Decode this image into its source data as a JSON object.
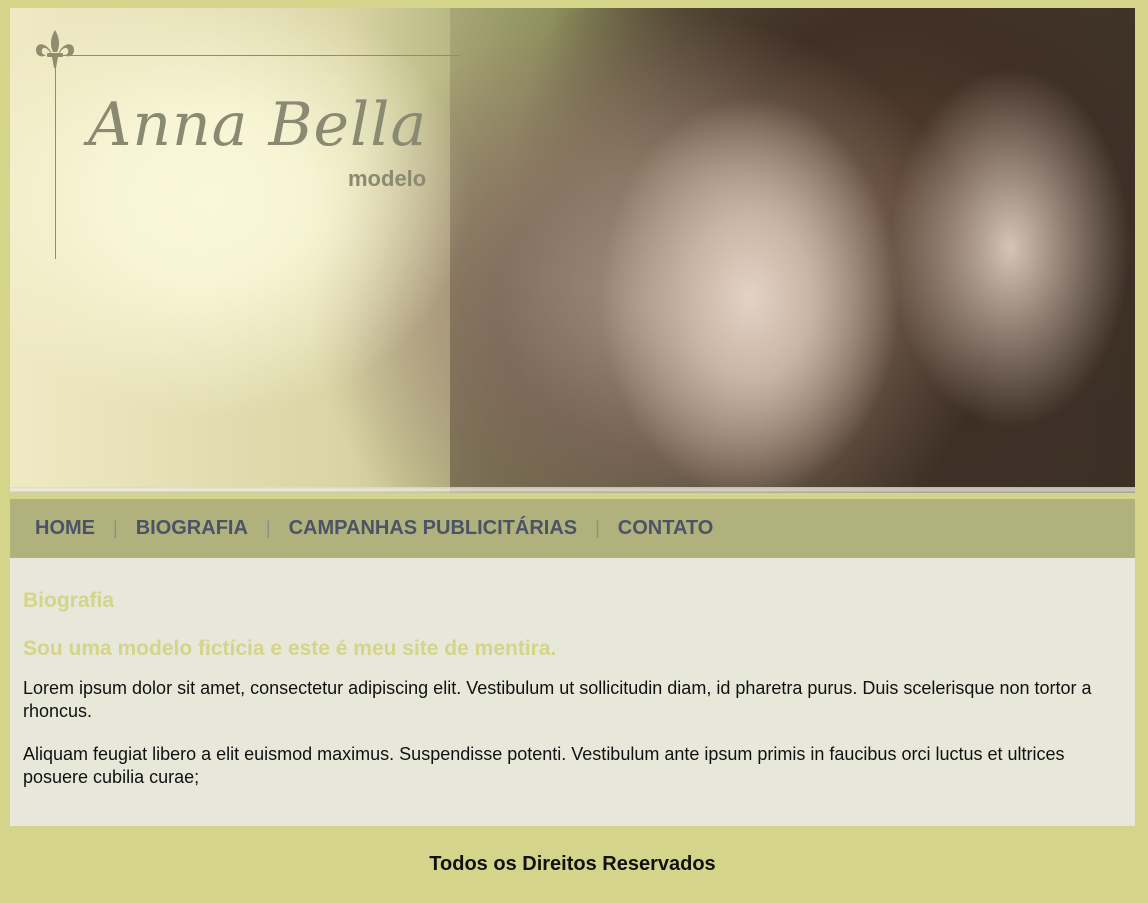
{
  "header": {
    "logo_name": "Anna Bella",
    "logo_sub": "modelo"
  },
  "nav": {
    "items": [
      {
        "label": "HOME"
      },
      {
        "label": "BIOGRAFIA"
      },
      {
        "label": "CAMPANHAS PUBLICITÁRIAS"
      },
      {
        "label": "CONTATO"
      }
    ],
    "separator": "|"
  },
  "content": {
    "title": "Biografia",
    "subtitle": "Sou uma modelo fictícia e este é meu site de mentira.",
    "paragraphs": [
      "Lorem ipsum dolor sit amet, consectetur adipiscing elit. Vestibulum ut sollicitudin diam, id pharetra purus. Duis scelerisque non tortor a rhoncus.",
      "Aliquam feugiat libero a elit euismod maximus. Suspendisse potenti. Vestibulum ante ipsum primis in faucibus orci luctus et ultrices posuere cubilia curae;"
    ]
  },
  "footer": {
    "text": "Todos os Direitos Reservados"
  },
  "colors": {
    "page_bg": "#d4d48a",
    "nav_bg": "#b1b17d",
    "nav_text": "#4b5466",
    "content_bg": "#e7e8d9",
    "heading": "#d4d48a"
  },
  "icons": {
    "logo": "fleur-de-lis-icon"
  }
}
